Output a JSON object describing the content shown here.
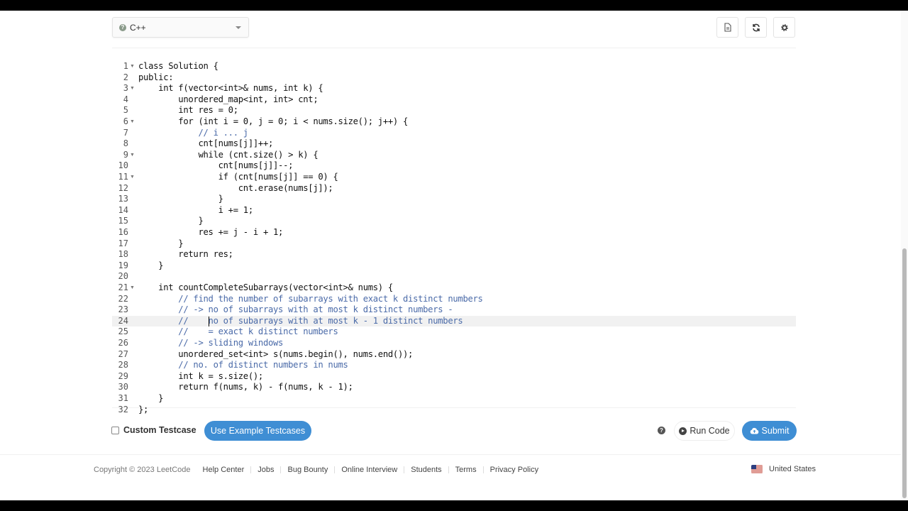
{
  "toolbar": {
    "language": "C++",
    "buttons": [
      {
        "name": "notes-button",
        "icon": "document-icon"
      },
      {
        "name": "reset-button",
        "icon": "refresh-icon"
      },
      {
        "name": "settings-button",
        "icon": "gear-icon"
      }
    ]
  },
  "editor": {
    "lines": [
      {
        "n": "1",
        "text": "class Solution {",
        "fold": true
      },
      {
        "n": "2",
        "text": "public:"
      },
      {
        "n": "3",
        "text": "    int f(vector<int>& nums, int k) {",
        "fold": true
      },
      {
        "n": "4",
        "text": "        unordered_map<int, int> cnt;"
      },
      {
        "n": "5",
        "text": "        int res = 0;"
      },
      {
        "n": "6",
        "text": "        for (int i = 0, j = 0; i < nums.size(); j++) {",
        "fold": true
      },
      {
        "n": "7",
        "text": "            // i ... j",
        "comment": true
      },
      {
        "n": "8",
        "text": "            cnt[nums[j]]++;"
      },
      {
        "n": "9",
        "text": "            while (cnt.size() > k) {",
        "fold": true
      },
      {
        "n": "10",
        "text": "                cnt[nums[j]]--;"
      },
      {
        "n": "11",
        "text": "                if (cnt[nums[j]] == 0) {",
        "fold": true
      },
      {
        "n": "12",
        "text": "                    cnt.erase(nums[j]);"
      },
      {
        "n": "13",
        "text": "                }"
      },
      {
        "n": "14",
        "text": "                i += 1;"
      },
      {
        "n": "15",
        "text": "            }"
      },
      {
        "n": "16",
        "text": "            res += j - i + 1;"
      },
      {
        "n": "17",
        "text": "        }"
      },
      {
        "n": "18",
        "text": "        return res;"
      },
      {
        "n": "19",
        "text": "    }"
      },
      {
        "n": "20",
        "text": ""
      },
      {
        "n": "21",
        "text": "    int countCompleteSubarrays(vector<int>& nums) {",
        "fold": true
      },
      {
        "n": "22",
        "text": "        // find the number of subarrays with exact k distinct numbers",
        "comment": true
      },
      {
        "n": "23",
        "text": "        // -> no of subarrays with at most k distinct numbers -",
        "comment": true
      },
      {
        "n": "24",
        "text": "        //    no of subarrays with at most k - 1 distinct numbers",
        "comment": true,
        "active": true
      },
      {
        "n": "25",
        "text": "        //    = exact k distinct numbers",
        "comment": true
      },
      {
        "n": "26",
        "text": "        // -> sliding windows",
        "comment": true
      },
      {
        "n": "27",
        "text": "        unordered_set<int> s(nums.begin(), nums.end());"
      },
      {
        "n": "28",
        "text": "        // no. of distinct numbers in nums",
        "comment": true
      },
      {
        "n": "29",
        "text": "        int k = s.size();"
      },
      {
        "n": "30",
        "text": "        return f(nums, k) - f(nums, k - 1);"
      },
      {
        "n": "31",
        "text": "    }"
      },
      {
        "n": "32",
        "text": "};"
      }
    ]
  },
  "actions": {
    "custom_testcase_label": "Custom Testcase",
    "custom_testcase_checked": false,
    "example_testcases_label": "Use Example Testcases",
    "run_label": "Run Code",
    "submit_label": "Submit"
  },
  "footer": {
    "copyright": "Copyright © 2023 LeetCode",
    "links": [
      "Help Center",
      "Jobs",
      "Bug Bounty",
      "Online Interview",
      "Students",
      "Terms",
      "Privacy Policy"
    ],
    "region": "United States"
  },
  "colors": {
    "accent": "#3f8ed4",
    "comment": "#4a6aa8"
  }
}
